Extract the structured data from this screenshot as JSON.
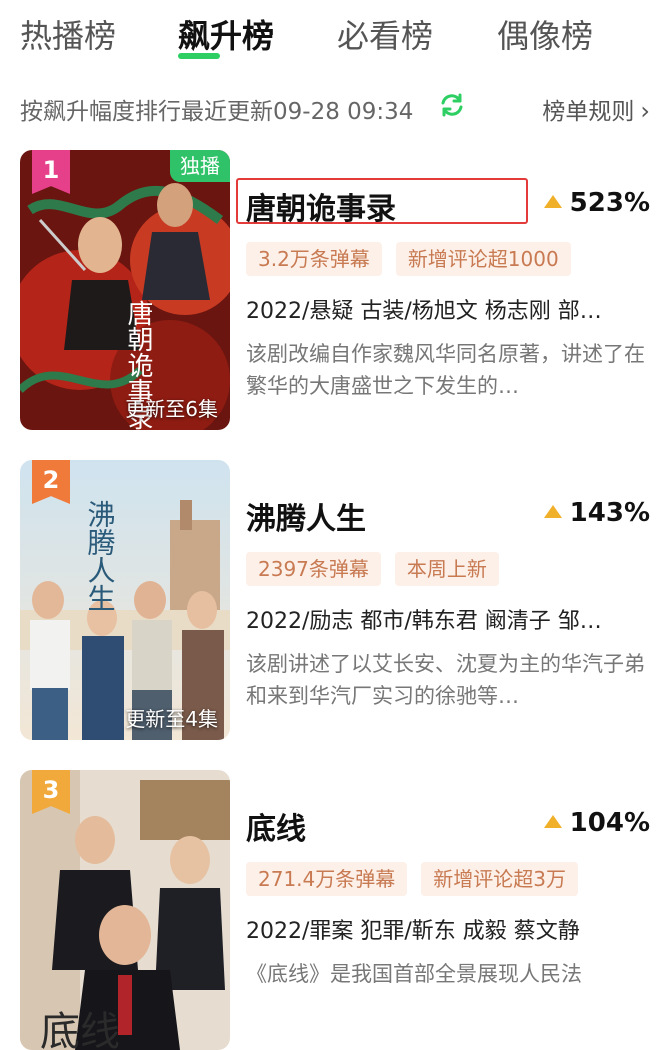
{
  "tabs": [
    {
      "label": "热播榜",
      "active": false
    },
    {
      "label": "飙升榜",
      "active": true
    },
    {
      "label": "必看榜",
      "active": false
    },
    {
      "label": "偶像榜",
      "active": false
    }
  ],
  "tab_accent_color": "#2ecf62",
  "rank_info": {
    "description": "按飙升幅度排行最近更新09-28 09:34",
    "refresh_icon": "refresh-icon",
    "rules_label": "榜单规则",
    "rules_chevron": "›"
  },
  "items": [
    {
      "rank": "1",
      "rank_color": "#e6408a",
      "exclusive": "独播",
      "episode": "更新至6集",
      "title": "唐朝诡事录",
      "rise": "523%",
      "tags": [
        "3.2万条弹幕",
        "新增评论超1000"
      ],
      "meta": "2022/悬疑 古装/杨旭文 杨志刚 部…",
      "description": "该剧改编自作家魏风华同名原著，讲述了在繁华的大唐盛世之下发生的…",
      "poster_text": "唐朝诡事录"
    },
    {
      "rank": "2",
      "rank_color": "#f07a3a",
      "exclusive": "",
      "episode": "更新至4集",
      "title": "沸腾人生",
      "rise": "143%",
      "tags": [
        "2397条弹幕",
        "本周上新"
      ],
      "meta": "2022/励志 都市/韩东君 阚清子 邹…",
      "description": "该剧讲述了以艾长安、沈夏为主的华汽子弟和来到华汽厂实习的徐驰等…",
      "poster_text": "沸腾人生"
    },
    {
      "rank": "3",
      "rank_color": "#f2a93c",
      "exclusive": "",
      "episode": "",
      "title": "底线",
      "rise": "104%",
      "tags": [
        "271.4万条弹幕",
        "新增评论超3万"
      ],
      "meta": "2022/罪案 犯罪/靳东 成毅 蔡文静",
      "description": "《底线》是我国首部全景展现人民法",
      "poster_text": "底线"
    }
  ],
  "colors": {
    "rise_triangle": "#f0b02a",
    "tag_bg": "#fdf0e8",
    "tag_text": "#c87a52",
    "highlight_box": "#e33a3a",
    "exclusive_tag": "#30c268"
  }
}
